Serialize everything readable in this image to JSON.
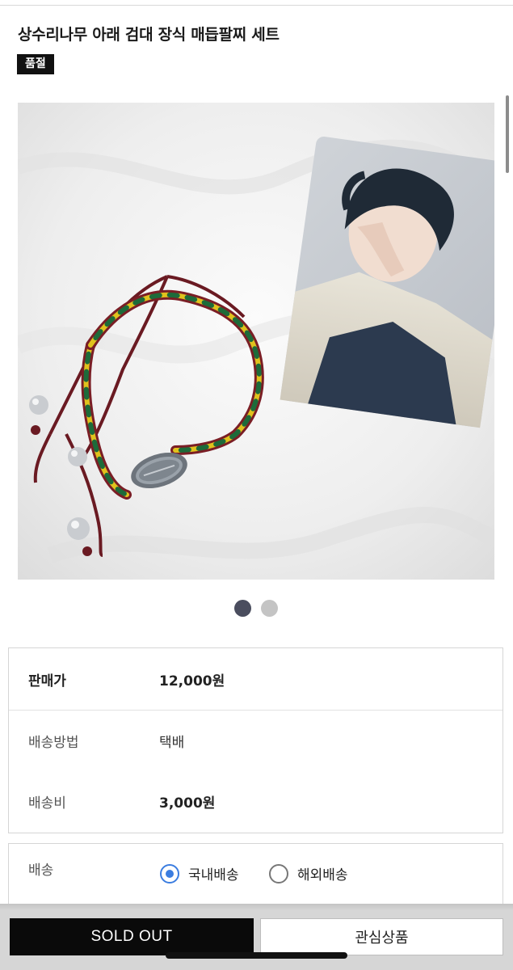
{
  "product": {
    "title": "상수리나무 아래 검대 장식 매듭팔찌 세트",
    "status_badge": "품절"
  },
  "gallery": {
    "image_description": "",
    "total_images": 2,
    "active_index": 1,
    "colors": {
      "active_dot": "#4a4d5e",
      "inactive_dot": "#c4c4c4"
    }
  },
  "info": {
    "price_label": "판매가",
    "price_value": "12,000원",
    "shipping_method_label": "배송방법",
    "shipping_method_value": "택배",
    "shipping_fee_label": "배송비",
    "shipping_fee_value": "3,000원"
  },
  "shipping": {
    "label": "배송",
    "options": [
      {
        "label": "국내배송",
        "selected": true
      },
      {
        "label": "해외배송",
        "selected": false
      }
    ],
    "accent_color": "#3b7de0"
  },
  "actions": {
    "sold_out_label": "SOLD OUT",
    "wishlist_label": "관심상품"
  }
}
